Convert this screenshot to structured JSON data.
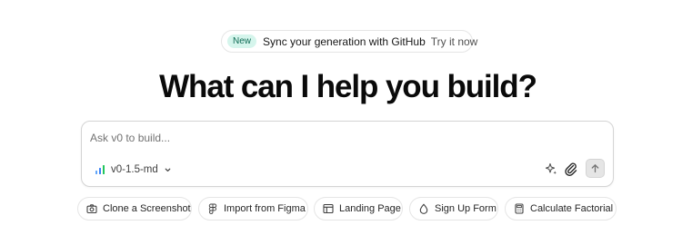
{
  "announcement": {
    "badge": "New",
    "text": "Sync your generation with GitHub",
    "cta": "Try it now",
    "cta_icon": "chevron-right-icon"
  },
  "headline": "What can I help you build?",
  "prompt": {
    "placeholder": "Ask v0 to build...",
    "value": "",
    "model": "v0-1.5-md",
    "model_icon": "signal-bars-icon",
    "accent_color": "#3b82f6",
    "tools": [
      "sparkles-icon",
      "paperclip-icon",
      "arrow-up-icon"
    ]
  },
  "suggestions": [
    {
      "label": "Clone a Screenshot",
      "icon": "camera-icon"
    },
    {
      "label": "Import from Figma",
      "icon": "figma-icon"
    },
    {
      "label": "Landing Page",
      "icon": "layout-icon"
    },
    {
      "label": "Sign Up Form",
      "icon": "droplet-icon"
    },
    {
      "label": "Calculate Factorial",
      "icon": "calculator-icon"
    }
  ]
}
